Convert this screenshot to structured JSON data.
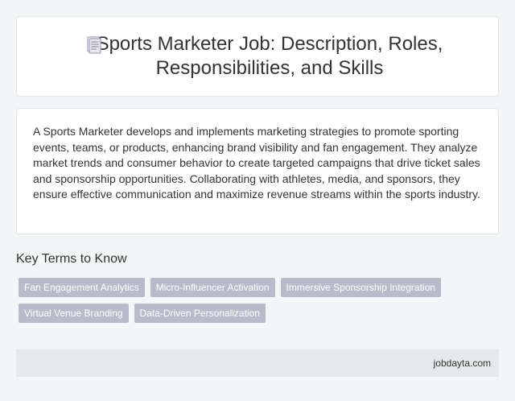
{
  "header": {
    "title": "Sports Marketer Job: Description, Roles, Responsibilities, and Skills",
    "icon": "document-icon"
  },
  "description": {
    "text": "A Sports Marketer develops and implements marketing strategies to promote sporting events, teams, or products, enhancing brand visibility and fan engagement. They analyze market trends and consumer behavior to create targeted campaigns that drive ticket sales and sponsorship opportunities. Collaborating with athletes, media, and sponsors, they ensure effective communication and maximize revenue streams within the sports industry."
  },
  "key_terms": {
    "heading": "Key Terms to Know",
    "tags": [
      "Fan Engagement Analytics",
      "Micro-Influencer Activation",
      "Immersive Sponsorship Integration",
      "Virtual Venue Branding",
      "Data-Driven Personalization"
    ]
  },
  "footer": {
    "site": "jobdayta.com"
  },
  "colors": {
    "background": "#f3f6f6",
    "card": "#ffffff",
    "tag_bg": "#b7bccb",
    "footer_bg": "#e2eaea",
    "text": "#333333"
  }
}
